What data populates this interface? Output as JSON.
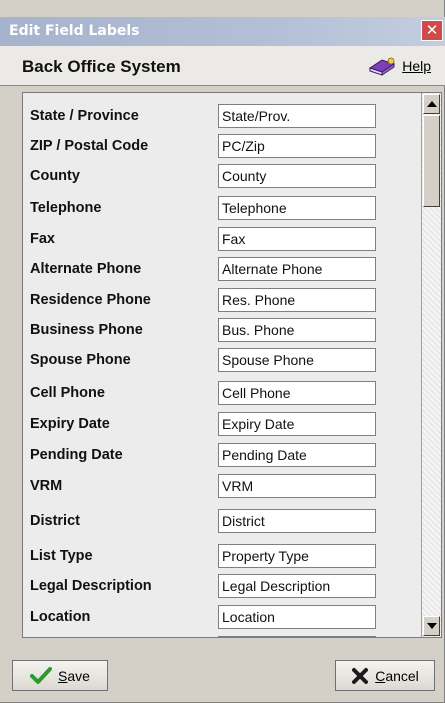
{
  "window": {
    "title": "Edit Field Labels",
    "close_symbol": "✕"
  },
  "header": {
    "app_title": "Back Office System",
    "help_label": "Help",
    "help_icon": "help-book-icon"
  },
  "fields": [
    {
      "label": "State / Province",
      "value": "State/Prov."
    },
    {
      "label": "ZIP / Postal Code",
      "value": "PC/Zip"
    },
    {
      "label": "County",
      "value": "County"
    },
    {
      "label": "Telephone",
      "value": "Telephone"
    },
    {
      "label": "Fax",
      "value": "Fax"
    },
    {
      "label": "Alternate Phone",
      "value": "Alternate Phone"
    },
    {
      "label": "Residence Phone",
      "value": "Res. Phone"
    },
    {
      "label": "Business Phone",
      "value": "Bus. Phone"
    },
    {
      "label": "Spouse Phone",
      "value": "Spouse Phone"
    },
    {
      "label": "Cell Phone",
      "value": "Cell Phone"
    },
    {
      "label": "Expiry Date",
      "value": "Expiry Date"
    },
    {
      "label": "Pending Date",
      "value": "Pending Date"
    },
    {
      "label": "VRM",
      "value": "VRM"
    },
    {
      "label": "District",
      "value": "District"
    },
    {
      "label": "List Type",
      "value": "Property Type"
    },
    {
      "label": "Legal Description",
      "value": "Legal Description"
    },
    {
      "label": "Location",
      "value": "Location"
    },
    {
      "label": "",
      "value": ""
    }
  ],
  "footer": {
    "save_label": "Save",
    "save_icon": "checkmark-icon",
    "cancel_label": "Cancel",
    "cancel_icon": "x-icon"
  },
  "colors": {
    "title_bar": "#b3bfd6",
    "close_button": "#d14a4a",
    "dialog_background": "#d4d0c8",
    "checkmark": "#2e9a2e",
    "cancel_x": "#1a1a1a"
  }
}
